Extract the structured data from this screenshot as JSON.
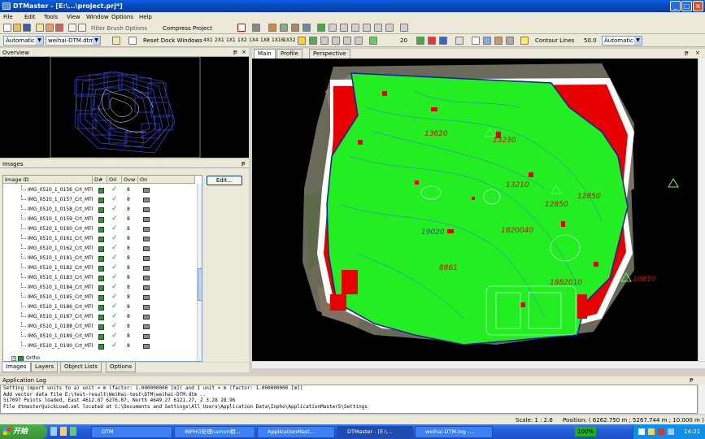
{
  "window": {
    "title": "DTMaster - [E:\\...\\project.prj*]",
    "min": "_",
    "max": "□",
    "close": "×"
  },
  "menu": [
    "File",
    "Edit",
    "Tools",
    "View",
    "Window",
    "Options",
    "Help"
  ],
  "toolbar1": {
    "filter_brush": "Filter Brush Options",
    "compress": "Compress Project"
  },
  "toolbar2": {
    "mode_select": "Automatic",
    "dtm_select": "weihai-DTM.dtm",
    "reset_dock": "Reset Dock Windows",
    "layouts": [
      "4X1",
      "2X1",
      "1X1",
      "1X2",
      "1X4",
      "1X8",
      "1X16",
      "1X32"
    ],
    "zoom_label": "20",
    "contour_label": "Contour Lines",
    "contour_value": "50.0",
    "contour_mode": "Automatic"
  },
  "panels": {
    "overview": "Overview",
    "images": "Images",
    "log": "Application Log",
    "pin": "ᵽ",
    "close": "×"
  },
  "images_table": {
    "columns": [
      "Image ID",
      "D#",
      "Ori",
      "Ovw",
      "On"
    ],
    "rows": [
      {
        "id": "IMG_0510_1_0156_Crt_MTI",
        "ovw": "8"
      },
      {
        "id": "IMG_0510_1_0157_Crt_MTI",
        "ovw": "8"
      },
      {
        "id": "IMG_0510_1_0158_Crt_MTI",
        "ovw": "8"
      },
      {
        "id": "IMG_0510_1_0159_Crt_MTI",
        "ovw": "8"
      },
      {
        "id": "IMG_0510_1_0160_Crt_MTI",
        "ovw": "8"
      },
      {
        "id": "IMG_0510_1_0161_Crt_MTI",
        "ovw": "8"
      },
      {
        "id": "IMG_0510_1_0162_Crt_MTI",
        "ovw": "8"
      },
      {
        "id": "IMG_0510_1_0181_Crt_MTI",
        "ovw": "8"
      },
      {
        "id": "IMG_0510_1_0182_Crt_MTI",
        "ovw": "8"
      },
      {
        "id": "IMG_0510_1_0183_Crt_MTI",
        "ovw": "8"
      },
      {
        "id": "IMG_0510_1_0184_Crt_MTI",
        "ovw": "8"
      },
      {
        "id": "IMG_0510_1_0185_Crt_MTI",
        "ovw": "8"
      },
      {
        "id": "IMG_0510_1_0186_Crt_MTI",
        "ovw": "8"
      },
      {
        "id": "IMG_0510_1_0187_Crt_MTI",
        "ovw": "8"
      },
      {
        "id": "IMG_0510_1_0188_Crt_MTI",
        "ovw": "8"
      },
      {
        "id": "IMG_0510_1_0189_Crt_MTI",
        "ovw": "8"
      },
      {
        "id": "IMG_0510_1_0190_Crt_MTI",
        "ovw": "8"
      }
    ],
    "ortho": "Ortho",
    "edit_button": "Edit..."
  },
  "left_tabs": [
    "Images",
    "Layers",
    "Object Lists",
    "Options"
  ],
  "main_tabs": [
    "Main",
    "Profile",
    "Perspective"
  ],
  "map_labels": [
    "13620",
    "13230",
    "13210",
    "12850",
    "12850",
    "19020",
    "1820040",
    "8861",
    "1882010",
    "10810"
  ],
  "log_lines": [
    "Setting import units to a) unit = m (factor: 1.000000000 [m]) and 1 unit = m (factor: 1.000000000 [m])",
    "Add vector data file E:\\test-result\\WeiHai-test\\DTM\\weihai-DTM.dtm ..",
    "517097 Points loaded, East 4612.87 6276.87, North 4649.27 6121.27, Z 3.28 28.96",
    "File dtmasterQuickLoad.xml located at C:\\Documents and Settings\\All Users\\Application Data\\Inpho\\ApplicationMaster5\\Settings"
  ],
  "status": {
    "scale": "Scale: 1 : 2.6",
    "position": "Position: ( 6262.750 m ; 5267.744 m ; 10.000 m )"
  },
  "taskbar": {
    "start": "开始",
    "tasks": [
      "DTM",
      "INPHO处理camon相...",
      "ApplicationMast...",
      "DTMaster - [E:\\...",
      "weihai-DTM.log -..."
    ],
    "zoom": "100%",
    "clock": "14:21"
  },
  "colors": {
    "dtm_fill": "#22ee22",
    "error_red": "#e60000",
    "boundary": "#1a1aa8",
    "contour_blue": "#3355ff"
  }
}
